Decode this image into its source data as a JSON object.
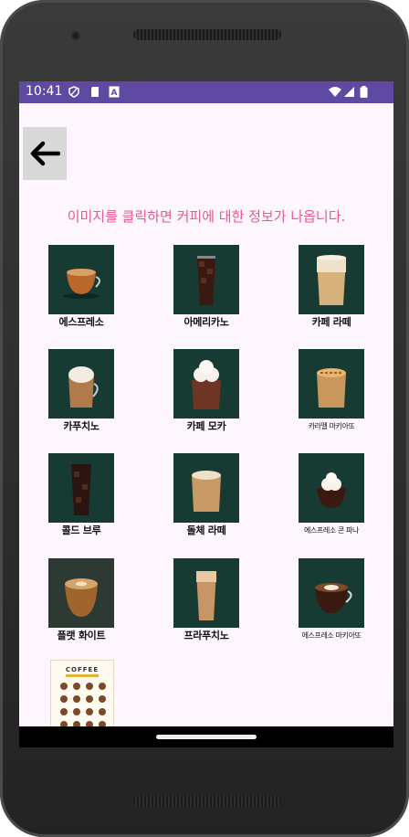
{
  "status_bar": {
    "time": "10:41"
  },
  "message": "이미지를 클릭하면 커피에 대한 정보가 나옵니다.",
  "colors": {
    "accent": "#e35a8d",
    "status_bar": "#5f4aa3",
    "tile_bg": "#173b33"
  },
  "poster": {
    "title": "COFFEE"
  },
  "menu": [
    {
      "label": "에스프레소"
    },
    {
      "label": "아메리카노"
    },
    {
      "label": "카페 라떼"
    },
    {
      "label": "카푸치노"
    },
    {
      "label": "카페 모카"
    },
    {
      "label": "카라멜 마키아또"
    },
    {
      "label": "콜드 브루"
    },
    {
      "label": "돌체 라떼"
    },
    {
      "label": "에스프레소 콘 파나"
    },
    {
      "label": "플랫 화이트"
    },
    {
      "label": "프라푸치노"
    },
    {
      "label": "에스프레소 마키아또"
    }
  ]
}
